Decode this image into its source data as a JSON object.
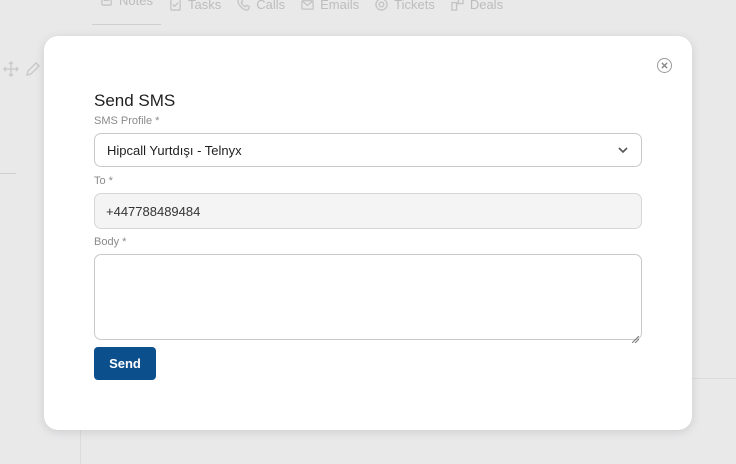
{
  "background": {
    "tabs": [
      {
        "label": "Notes",
        "icon": "note-icon"
      },
      {
        "label": "Tasks",
        "icon": "task-icon"
      },
      {
        "label": "Calls",
        "icon": "phone-icon"
      },
      {
        "label": "Emails",
        "icon": "mail-icon"
      },
      {
        "label": "Tickets",
        "icon": "ticket-icon"
      },
      {
        "label": "Deals",
        "icon": "deal-icon"
      }
    ]
  },
  "modal": {
    "title": "Send SMS",
    "close_icon": "close-circle-icon",
    "sms_profile": {
      "label": "SMS Profile *",
      "value": "Hipcall Yurtdışı - Telnyx",
      "icon": "chevron-down-icon"
    },
    "to": {
      "label": "To *",
      "value": "+447788489484"
    },
    "body": {
      "label": "Body *",
      "value": ""
    },
    "send_button": "Send"
  },
  "colors": {
    "primary": "#0b4f8c",
    "overlay": "#e9e9ea"
  }
}
